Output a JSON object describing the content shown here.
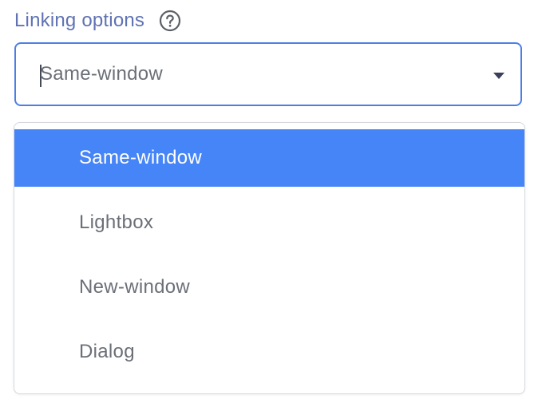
{
  "field": {
    "label": "Linking options",
    "help_icon": "question-circle-icon"
  },
  "select": {
    "value": "Same-window",
    "arrow_icon": "triangle-down-icon"
  },
  "menu": {
    "items": [
      {
        "label": "Same-window",
        "selected": true
      },
      {
        "label": "Lightbox",
        "selected": false
      },
      {
        "label": "New-window",
        "selected": false
      },
      {
        "label": "Dialog",
        "selected": false
      }
    ]
  },
  "colors": {
    "label": "#5f72b3",
    "focus_border": "#4c7fe6",
    "selected_bg": "#4685f7",
    "text": "#6b6f77"
  }
}
